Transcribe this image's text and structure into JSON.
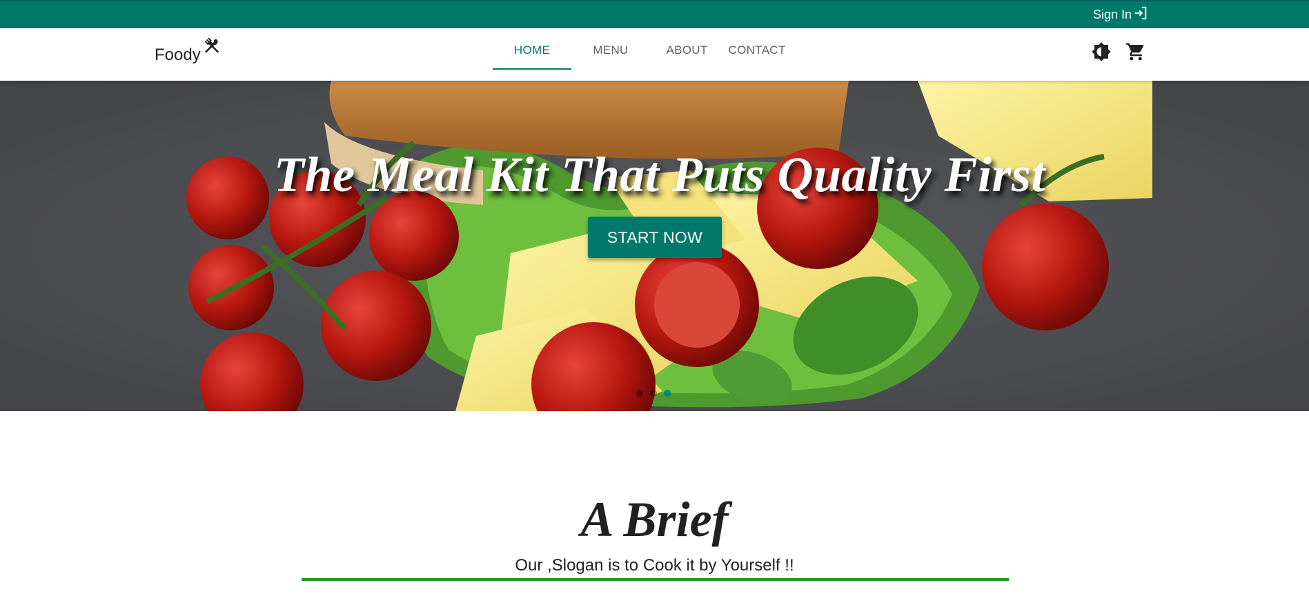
{
  "topbar": {
    "signin_label": "Sign In",
    "signin_icon": "login-icon",
    "bg_color": "#00796b"
  },
  "navbar": {
    "brand": "Foody",
    "brand_icon": "fork-spoon-icon",
    "tabs": [
      {
        "label": "HOME",
        "active": true
      },
      {
        "label": "MENU",
        "active": false
      },
      {
        "label": "ABOUT",
        "active": false
      },
      {
        "label": "CONTACT",
        "active": false
      }
    ],
    "icons": [
      "theme-toggle-icon",
      "cart-icon"
    ],
    "accent_color": "#00796b"
  },
  "hero": {
    "title": "The Meal Kit That Puts Quality First",
    "button_label": "START NOW",
    "carousel_slides": 3,
    "active_slide": 3
  },
  "brief": {
    "title": "A Brief",
    "slogan": "Our ,Slogan is to Cook it by Yourself !!",
    "underline_color": "#1e9a1e"
  }
}
